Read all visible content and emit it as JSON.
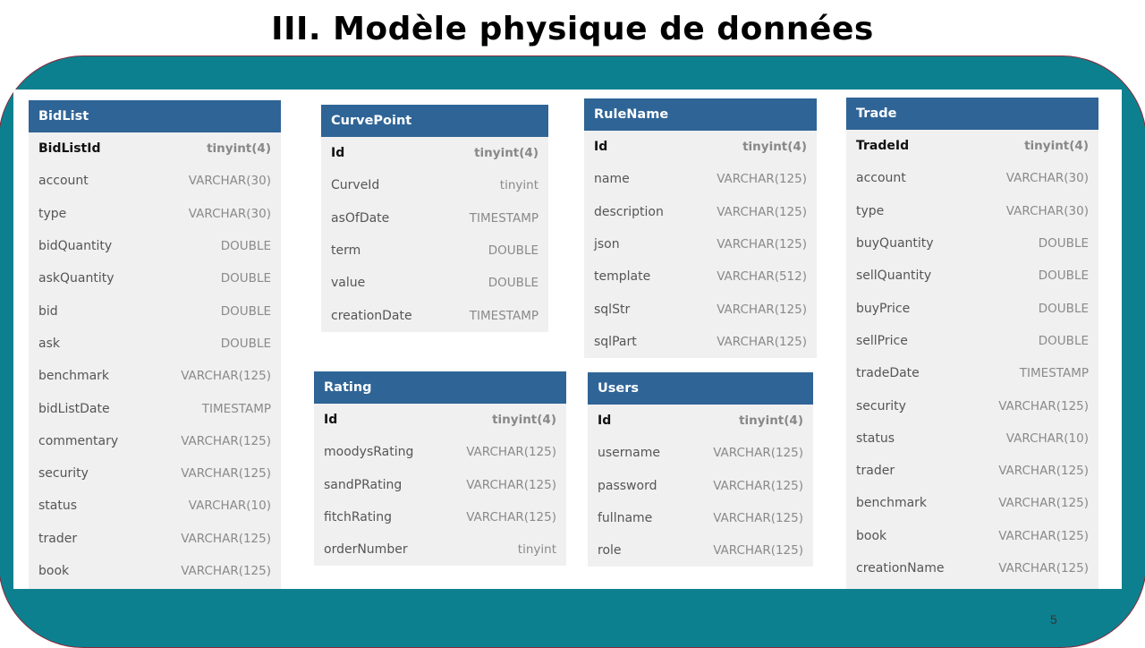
{
  "slide": {
    "title": "III. Modèle physique de données",
    "page_number": "5"
  },
  "tables": {
    "bidlist": {
      "name": "BidList",
      "columns": [
        {
          "name": "BidListId",
          "type": "tinyint(4)"
        },
        {
          "name": "account",
          "type": "VARCHAR(30)"
        },
        {
          "name": "type",
          "type": "VARCHAR(30)"
        },
        {
          "name": "bidQuantity",
          "type": "DOUBLE"
        },
        {
          "name": "askQuantity",
          "type": "DOUBLE"
        },
        {
          "name": "bid",
          "type": "DOUBLE"
        },
        {
          "name": "ask",
          "type": "DOUBLE"
        },
        {
          "name": "benchmark",
          "type": "VARCHAR(125)"
        },
        {
          "name": "bidListDate",
          "type": "TIMESTAMP"
        },
        {
          "name": "commentary",
          "type": "VARCHAR(125)"
        },
        {
          "name": "security",
          "type": "VARCHAR(125)"
        },
        {
          "name": "status",
          "type": "VARCHAR(10)"
        },
        {
          "name": "trader",
          "type": "VARCHAR(125)"
        },
        {
          "name": "book",
          "type": "VARCHAR(125)"
        }
      ]
    },
    "curvepoint": {
      "name": "CurvePoint",
      "columns": [
        {
          "name": "Id",
          "type": "tinyint(4)"
        },
        {
          "name": "CurveId",
          "type": "tinyint"
        },
        {
          "name": "asOfDate",
          "type": "TIMESTAMP"
        },
        {
          "name": "term",
          "type": "DOUBLE"
        },
        {
          "name": "value",
          "type": "DOUBLE"
        },
        {
          "name": "creationDate",
          "type": "TIMESTAMP"
        }
      ]
    },
    "rulename": {
      "name": "RuleName",
      "columns": [
        {
          "name": "Id",
          "type": "tinyint(4)"
        },
        {
          "name": "name",
          "type": "VARCHAR(125)"
        },
        {
          "name": "description",
          "type": "VARCHAR(125)"
        },
        {
          "name": "json",
          "type": "VARCHAR(125)"
        },
        {
          "name": "template",
          "type": "VARCHAR(512)"
        },
        {
          "name": "sqlStr",
          "type": "VARCHAR(125)"
        },
        {
          "name": "sqlPart",
          "type": "VARCHAR(125)"
        }
      ]
    },
    "trade": {
      "name": "Trade",
      "columns": [
        {
          "name": "TradeId",
          "type": "tinyint(4)"
        },
        {
          "name": "account",
          "type": "VARCHAR(30)"
        },
        {
          "name": "type",
          "type": "VARCHAR(30)"
        },
        {
          "name": "buyQuantity",
          "type": "DOUBLE"
        },
        {
          "name": "sellQuantity",
          "type": "DOUBLE"
        },
        {
          "name": "buyPrice",
          "type": "DOUBLE"
        },
        {
          "name": "sellPrice",
          "type": "DOUBLE"
        },
        {
          "name": "tradeDate",
          "type": "TIMESTAMP"
        },
        {
          "name": "security",
          "type": "VARCHAR(125)"
        },
        {
          "name": "status",
          "type": "VARCHAR(10)"
        },
        {
          "name": "trader",
          "type": "VARCHAR(125)"
        },
        {
          "name": "benchmark",
          "type": "VARCHAR(125)"
        },
        {
          "name": "book",
          "type": "VARCHAR(125)"
        },
        {
          "name": "creationName",
          "type": "VARCHAR(125)"
        }
      ]
    },
    "rating": {
      "name": "Rating",
      "columns": [
        {
          "name": "Id",
          "type": "tinyint(4)"
        },
        {
          "name": "moodysRating",
          "type": "VARCHAR(125)"
        },
        {
          "name": "sandPRating",
          "type": "VARCHAR(125)"
        },
        {
          "name": "fitchRating",
          "type": "VARCHAR(125)"
        },
        {
          "name": "orderNumber",
          "type": "tinyint"
        }
      ]
    },
    "users": {
      "name": "Users",
      "columns": [
        {
          "name": "Id",
          "type": "tinyint(4)"
        },
        {
          "name": "username",
          "type": "VARCHAR(125)"
        },
        {
          "name": "password",
          "type": "VARCHAR(125)"
        },
        {
          "name": "fullname",
          "type": "VARCHAR(125)"
        },
        {
          "name": "role",
          "type": "VARCHAR(125)"
        }
      ]
    }
  }
}
